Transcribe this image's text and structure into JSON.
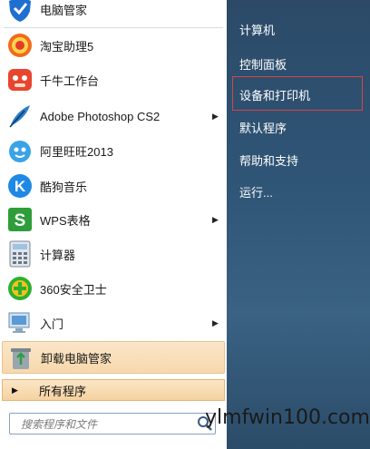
{
  "left_menu": {
    "items": [
      {
        "label": "电脑管家",
        "icon": "shield-icon"
      },
      {
        "label": "淘宝助理5",
        "icon": "taobao-icon"
      },
      {
        "label": "千牛工作台",
        "icon": "qianniu-icon"
      },
      {
        "label": "Adobe Photoshop CS2",
        "icon": "feather-icon"
      },
      {
        "label": "阿里旺旺2013",
        "icon": "wangwang-icon"
      },
      {
        "label": "酷狗音乐",
        "icon": "kugou-icon"
      },
      {
        "label": "WPS表格",
        "icon": "wps-icon"
      },
      {
        "label": "计算器",
        "icon": "calculator-icon"
      },
      {
        "label": "360安全卫士",
        "icon": "360-icon"
      },
      {
        "label": "入门",
        "icon": "getting-started-icon"
      },
      {
        "label": "卸载电脑管家",
        "icon": "recycle-icon"
      }
    ],
    "all_programs": "所有程序",
    "search_placeholder": "搜索程序和文件"
  },
  "right_menu": {
    "items": [
      "计算机",
      "控制面板",
      "设备和打印机",
      "默认程序",
      "帮助和支持",
      "运行..."
    ]
  },
  "watermark": "ylmfwin100.com",
  "colors": {
    "highlight_border": "#d34545",
    "accent_orange": "#f7d8ad",
    "panel_blue": "#2f5576"
  }
}
